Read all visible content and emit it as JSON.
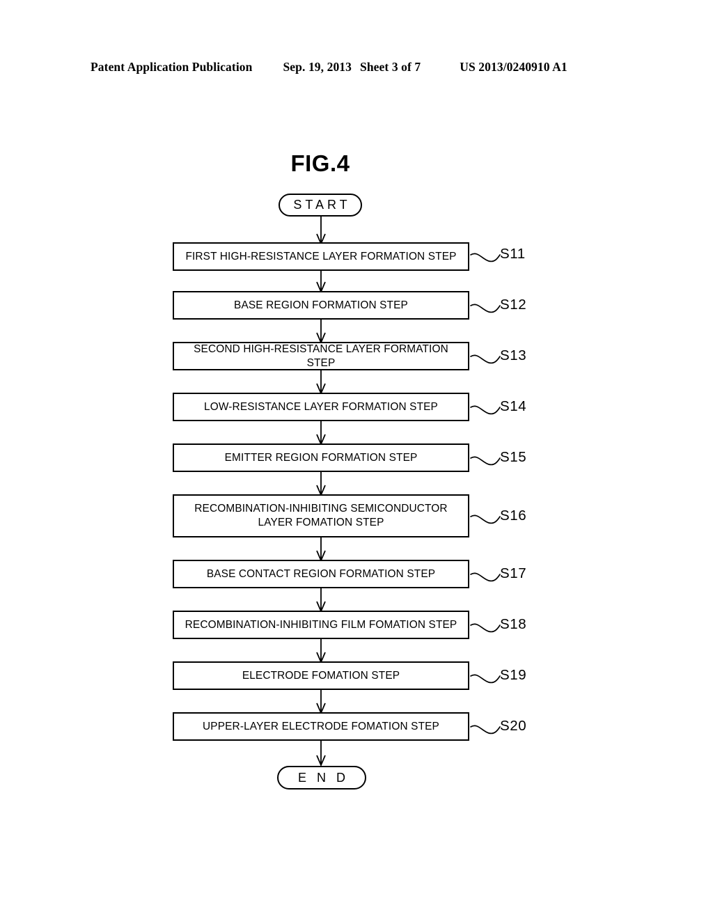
{
  "header": {
    "publication": "Patent Application Publication",
    "date": "Sep. 19, 2013",
    "sheet": "Sheet 3 of 7",
    "document_number": "US 2013/0240910 A1"
  },
  "figure": {
    "title": "FIG.4"
  },
  "flowchart": {
    "start_label": "START",
    "end_label": "E N D",
    "steps": [
      {
        "ref": "S11",
        "text": "FIRST HIGH-RESISTANCE LAYER FORMATION STEP"
      },
      {
        "ref": "S12",
        "text": "BASE REGION FORMATION STEP"
      },
      {
        "ref": "S13",
        "text": "SECOND HIGH-RESISTANCE LAYER FORMATION STEP"
      },
      {
        "ref": "S14",
        "text": "LOW-RESISTANCE LAYER FORMATION STEP"
      },
      {
        "ref": "S15",
        "text": "EMITTER REGION FORMATION STEP"
      },
      {
        "ref": "S16",
        "text": "RECOMBINATION-INHIBITING SEMICONDUCTOR LAYER FOMATION STEP"
      },
      {
        "ref": "S17",
        "text": "BASE CONTACT REGION FORMATION STEP"
      },
      {
        "ref": "S18",
        "text": "RECOMBINATION-INHIBITING FILM FOMATION STEP"
      },
      {
        "ref": "S19",
        "text": "ELECTRODE FOMATION STEP"
      },
      {
        "ref": "S20",
        "text": "UPPER-LAYER ELECTRODE FOMATION STEP"
      }
    ]
  },
  "colors": {
    "ink": "#000000",
    "paper": "#ffffff"
  }
}
